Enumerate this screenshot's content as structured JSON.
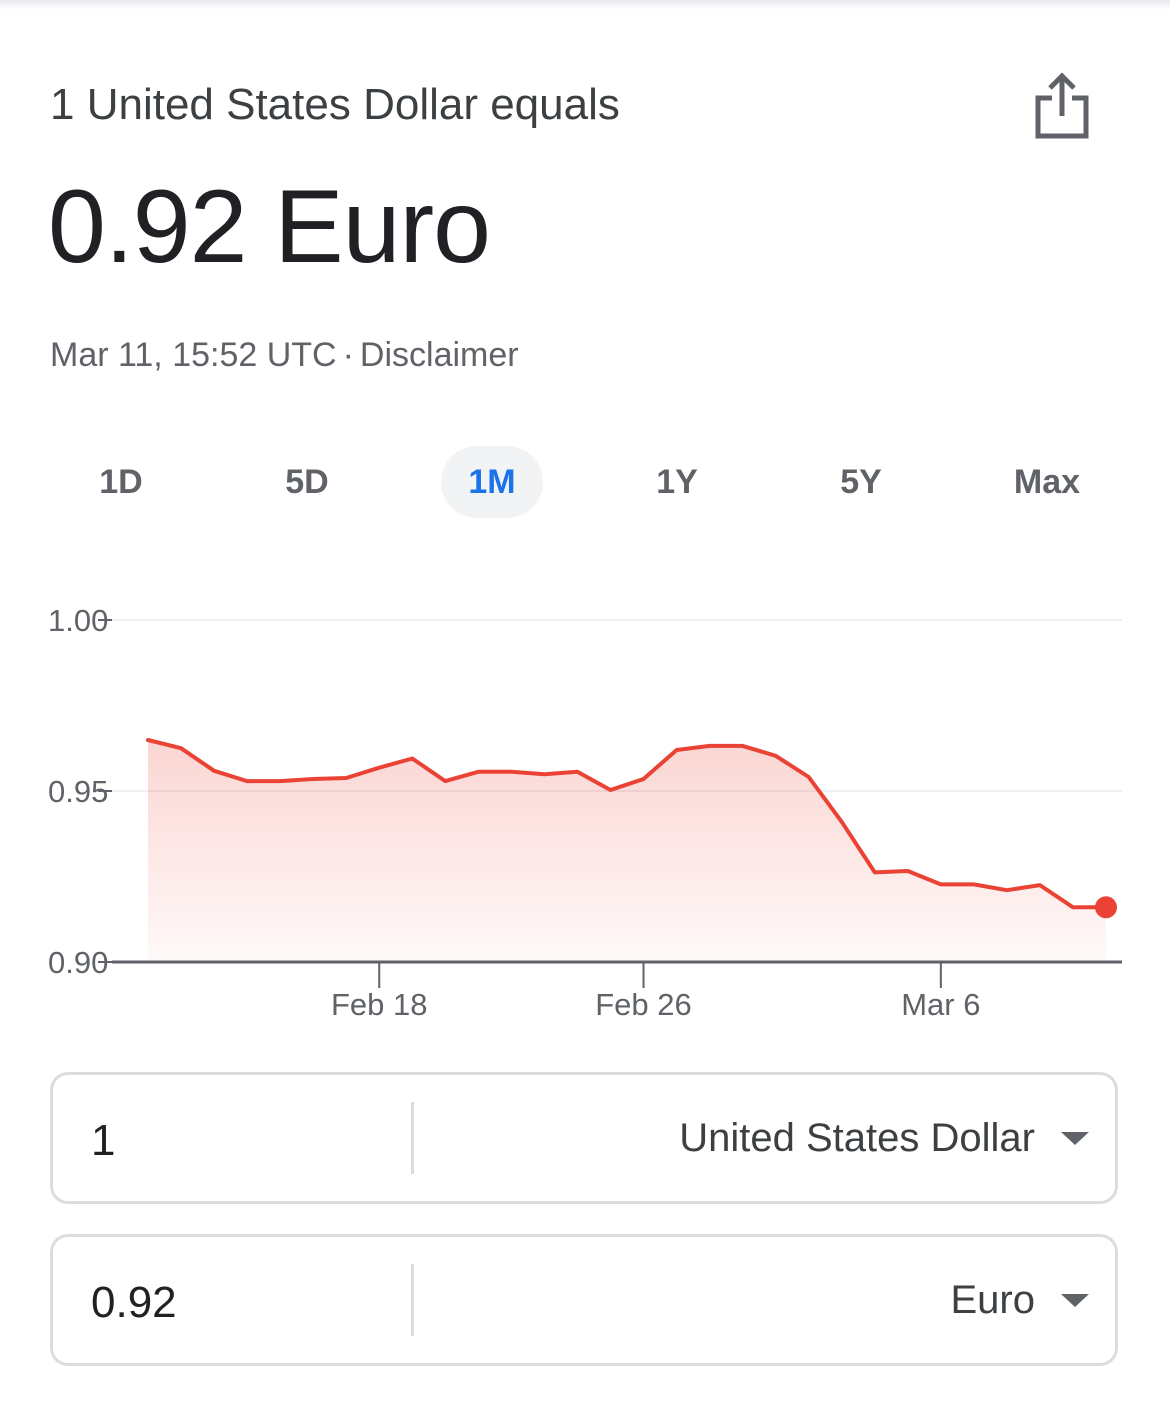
{
  "header": {
    "base_line": "1 United States Dollar equals",
    "result_value": "0.92 Euro",
    "timestamp": "Mar 11, 15:52 UTC",
    "separator": "·",
    "disclaimer": "Disclaimer",
    "share_icon": "share-icon"
  },
  "range_tabs": [
    {
      "label": "1D",
      "active": false
    },
    {
      "label": "5D",
      "active": false
    },
    {
      "label": "1M",
      "active": true
    },
    {
      "label": "1Y",
      "active": false
    },
    {
      "label": "5Y",
      "active": false
    },
    {
      "label": "Max",
      "active": false
    }
  ],
  "colors": {
    "line": "#ea4335",
    "active_tab": "#1a73e8",
    "axis": "#5f6368",
    "grid": "#eeeff1"
  },
  "chart_data": {
    "type": "area",
    "ylim": [
      0.9,
      1.0
    ],
    "yticks": [
      "1.00",
      "0.95",
      "0.90"
    ],
    "xticks": [
      "Feb 18",
      "Feb 26",
      "Mar 6"
    ],
    "grid": true,
    "x": [
      "Feb 11",
      "Feb 12",
      "Feb 13",
      "Feb 14",
      "Feb 15",
      "Feb 16",
      "Feb 17",
      "Feb 18",
      "Feb 19",
      "Feb 20",
      "Feb 21",
      "Feb 22",
      "Feb 23",
      "Feb 24",
      "Feb 25",
      "Feb 26",
      "Feb 27",
      "Feb 28",
      "Feb 29",
      "Mar 1",
      "Mar 2",
      "Mar 3",
      "Mar 4",
      "Mar 5",
      "Mar 6",
      "Mar 7",
      "Mar 8",
      "Mar 9",
      "Mar 10",
      "Mar 11"
    ],
    "series": [
      {
        "values": [
          0.9649,
          0.9625,
          0.9559,
          0.9529,
          0.9529,
          0.9535,
          0.9538,
          0.9568,
          0.9595,
          0.9529,
          0.9556,
          0.9556,
          0.9549,
          0.9556,
          0.9503,
          0.9535,
          0.962,
          0.9632,
          0.9632,
          0.9603,
          0.9541,
          0.941,
          0.9262,
          0.9266,
          0.9227,
          0.9227,
          0.921,
          0.9225,
          0.916,
          0.916
        ]
      }
    ],
    "current_point": {
      "x": "Mar 11",
      "value": 0.916
    }
  },
  "converter": {
    "from": {
      "amount": "1",
      "currency": "United States Dollar",
      "caret_icon": "caret-down-icon"
    },
    "to": {
      "amount": "0.92",
      "currency": "Euro",
      "caret_icon": "caret-down-icon"
    }
  }
}
